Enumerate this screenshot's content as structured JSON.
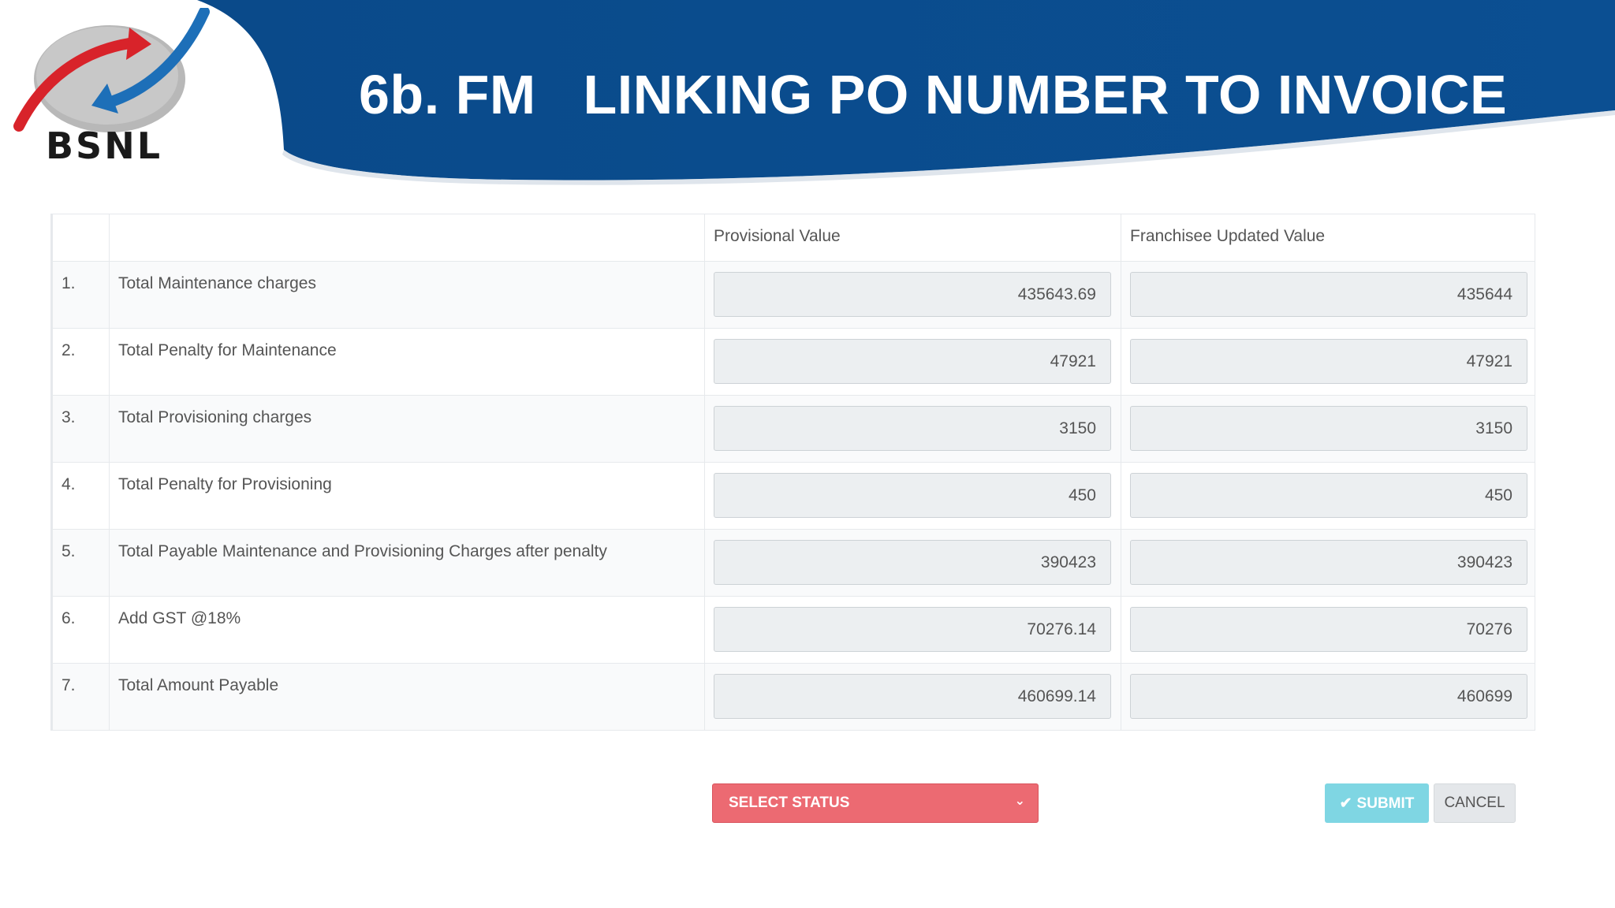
{
  "slide": {
    "title": "6b. FM   LINKING PO NUMBER TO INVOICE",
    "logo_text": "BSNL",
    "banner_color": "#0a4a8a",
    "logo_red": "#d8232a",
    "logo_blue": "#1d6fb8"
  },
  "table": {
    "headers": [
      "",
      "",
      "Provisional Value",
      "Franchisee Updated Value"
    ],
    "rows": [
      {
        "num": "1.",
        "label": "Total Maintenance charges",
        "provisional": "435643.69",
        "franchisee": "435644"
      },
      {
        "num": "2.",
        "label": "Total Penalty for Maintenance",
        "provisional": "47921",
        "franchisee": "47921"
      },
      {
        "num": "3.",
        "label": "Total Provisioning charges",
        "provisional": "3150",
        "franchisee": "3150"
      },
      {
        "num": "4.",
        "label": "Total Penalty for Provisioning",
        "provisional": "450",
        "franchisee": "450"
      },
      {
        "num": "5.",
        "label": "Total Payable Maintenance and Provisioning Charges after penalty",
        "provisional": "390423",
        "franchisee": "390423"
      },
      {
        "num": "6.",
        "label": "Add GST @18%",
        "provisional": "70276.14",
        "franchisee": "70276"
      },
      {
        "num": "7.",
        "label": "Total Amount Payable",
        "provisional": "460699.14",
        "franchisee": "460699"
      }
    ]
  },
  "actions": {
    "select_status": "SELECT STATUS",
    "submit": "SUBMIT",
    "cancel": "CANCEL",
    "select_color": "#ec6a72",
    "submit_color": "#7fd6e3"
  }
}
